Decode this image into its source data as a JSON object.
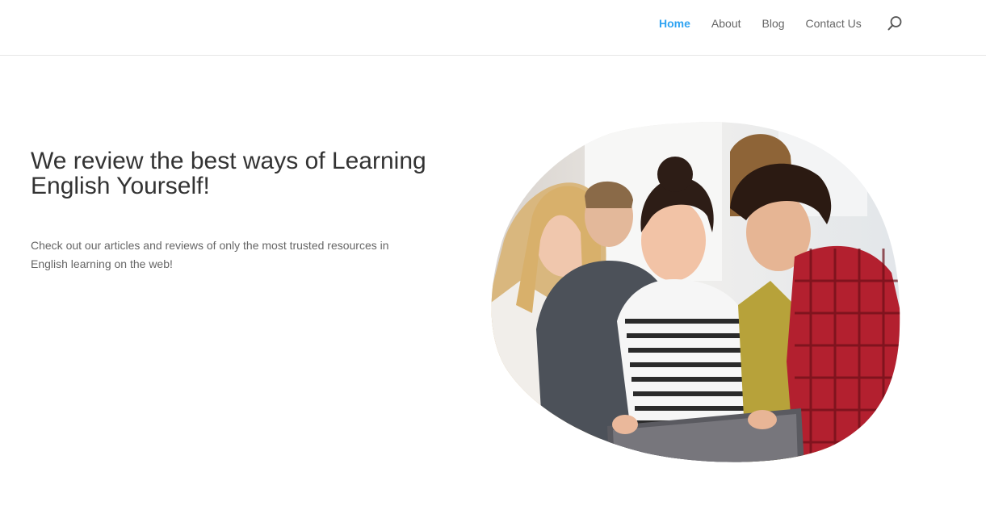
{
  "nav": {
    "items": [
      {
        "label": "Home",
        "active": true
      },
      {
        "label": "About",
        "active": false
      },
      {
        "label": "Blog",
        "active": false
      },
      {
        "label": "Contact Us",
        "active": false
      }
    ],
    "search_icon": "search-icon",
    "active_color": "#2ea3f2",
    "text_color": "#666666"
  },
  "hero": {
    "title": "We review the best ways of Learning English Yourself!",
    "description": "Check out our articles and reviews of only the most trusted resources in English learning on the web!",
    "image": "group-of-students-at-laptop-photo"
  }
}
